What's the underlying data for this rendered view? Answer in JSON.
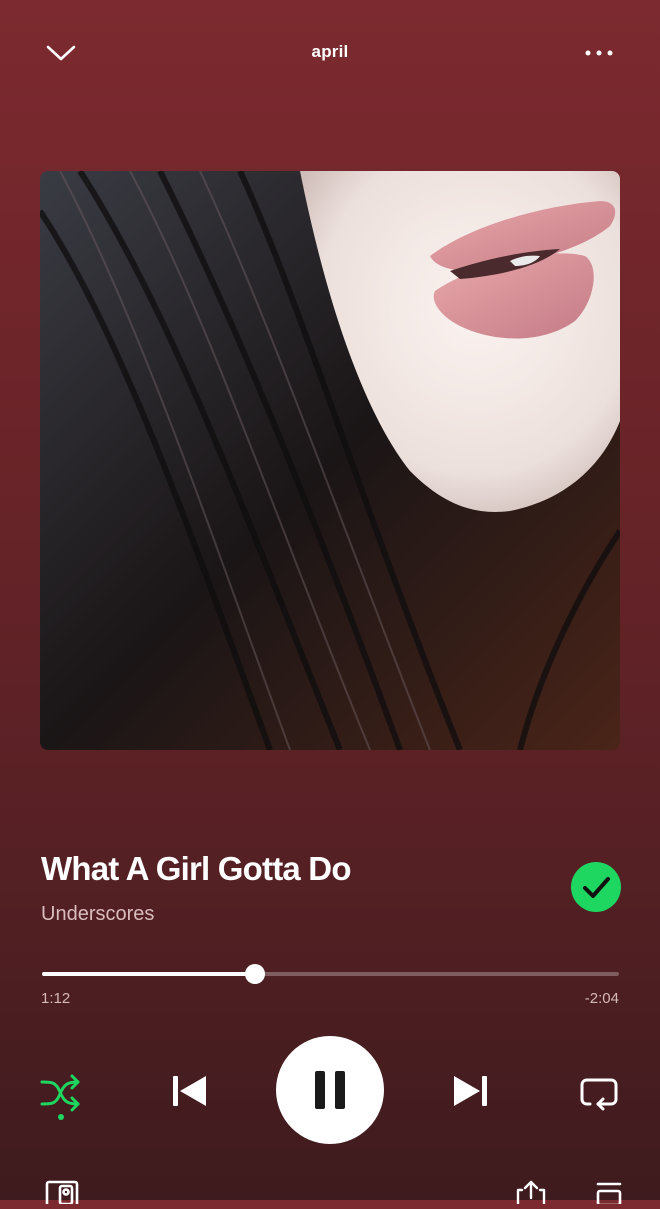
{
  "header": {
    "title": "april",
    "collapse_icon": "chevron-down-icon",
    "menu_icon": "more-horizontal-icon"
  },
  "track": {
    "title": "What A Girl Gotta Do",
    "artist": "Underscores",
    "liked": true,
    "liked_icon": "check-circle-icon"
  },
  "playback": {
    "elapsed": "1:12",
    "remaining": "-2:04",
    "progress_fraction": 0.37,
    "state": "playing",
    "shuffle_enabled": true
  },
  "controls": {
    "shuffle_icon": "shuffle-icon",
    "previous_icon": "skip-previous-icon",
    "pause_icon": "pause-icon",
    "next_icon": "skip-next-icon",
    "repeat_icon": "repeat-icon"
  },
  "bottom_bar": {
    "devices_icon": "devices-icon",
    "share_icon": "share-icon",
    "queue_icon": "queue-icon"
  },
  "colors": {
    "accent": "#1ed760",
    "background_top": "#7c2a2f",
    "background_bottom": "#3e1b1e"
  }
}
